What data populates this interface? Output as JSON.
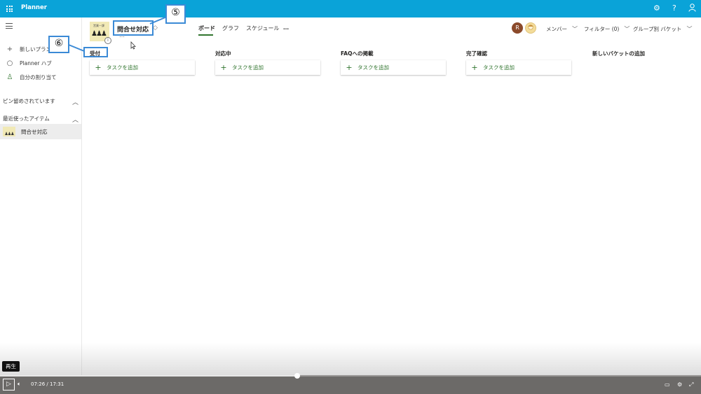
{
  "topbar": {
    "app_name": "Planner",
    "settings_icon": "gear-icon",
    "help_label": "?",
    "account_icon": "person-icon"
  },
  "sidebar": {
    "items": [
      {
        "icon": "plus-icon",
        "glyph": "+",
        "label": "新しいプラン"
      },
      {
        "icon": "circle-icon",
        "glyph": "○",
        "label": "Planner ハブ"
      },
      {
        "icon": "person-icon",
        "glyph": "♙",
        "label": "自分の割り当て"
      }
    ],
    "pinned_section": "ピン留めされています",
    "recent_section": "最近使ったアイテム",
    "recent_items": [
      {
        "label": "問合せ対応"
      }
    ]
  },
  "plan": {
    "title": "問合せ対応",
    "icon_tag": "営業一課",
    "more": "…",
    "info": "i"
  },
  "tabs": [
    {
      "label": "ボード",
      "active": true
    },
    {
      "label": "グラフ",
      "active": false
    },
    {
      "label": "スケジュール",
      "active": false
    },
    {
      "label": "…",
      "active": false
    }
  ],
  "header_controls": {
    "members_label": "メンバー",
    "filter_label": "フィルター (0)",
    "group_label": "グループ別 バケット",
    "avatar1_letter": "R"
  },
  "buckets": [
    {
      "name": "受付",
      "add_label": "タスクを追加"
    },
    {
      "name": "対応中",
      "add_label": "タスクを追加"
    },
    {
      "name": "FAQへの掲載",
      "add_label": "タスクを追加"
    },
    {
      "name": "完了確認",
      "add_label": "タスクを追加"
    },
    {
      "name": "新しいバケットの追加"
    }
  ],
  "callouts": [
    {
      "number": "⑤",
      "text": "問合せ対応"
    },
    {
      "number": "⑥",
      "text": "受付"
    }
  ],
  "player": {
    "tooltip": "再生",
    "current_time": "07:26",
    "separator": "/",
    "total_time": "17:31",
    "progress": 0.424
  },
  "colors": {
    "topbar": "#0aa3d8",
    "accent_green": "#31752f",
    "callout_border": "#3b8ad6",
    "avatar_brown": "#8b4a2b"
  }
}
